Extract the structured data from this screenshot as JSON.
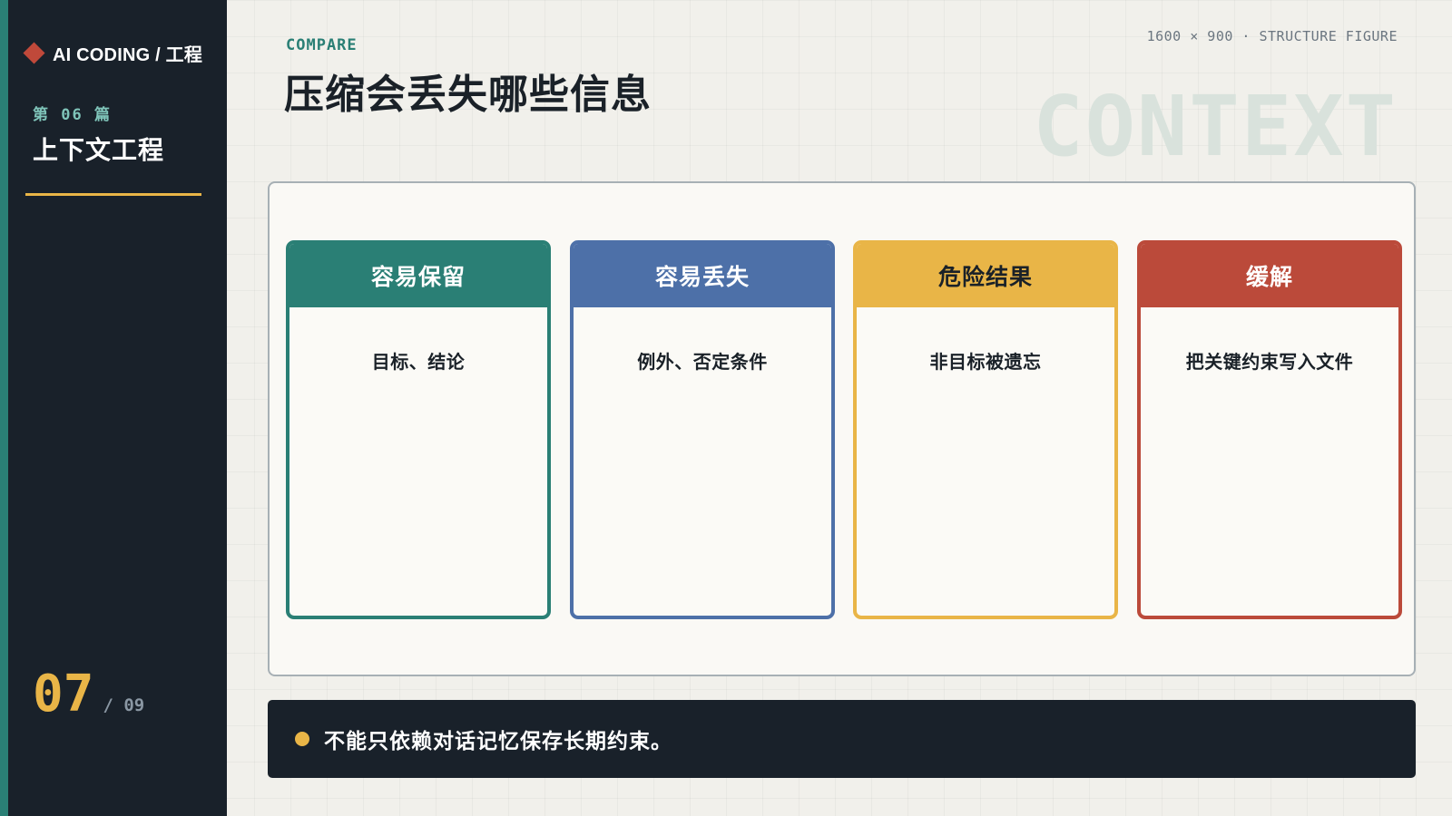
{
  "sidebar": {
    "brand": "AI CODING / 工程",
    "brand_icon": "diamond-icon",
    "episode": "第 06 篇",
    "episode_title": "上下文工程",
    "page_current": "07",
    "page_total": "/ 09"
  },
  "header": {
    "kicker": "COMPARE",
    "title": "压缩会丢失哪些信息",
    "dimension_label": "1600 × 900 · STRUCTURE FIGURE",
    "watermark": "CONTEXT"
  },
  "cards": [
    {
      "title": "容易保留",
      "body": "目标、结论",
      "color": "#2a7f75",
      "title_color": "#ffffff"
    },
    {
      "title": "容易丢失",
      "body": "例外、否定条件",
      "color": "#4d70a8",
      "title_color": "#ffffff"
    },
    {
      "title": "危险结果",
      "body": "非目标被遗忘",
      "color": "#e9b547",
      "title_color": "#1a2128"
    },
    {
      "title": "缓解",
      "body": "把关键约束写入文件",
      "color": "#bb4a3a",
      "title_color": "#ffffff"
    }
  ],
  "callout": {
    "text": "不能只依赖对话记忆保存长期约束。"
  },
  "colors": {
    "sidebar_bg": "#19212a",
    "accent_teal": "#2a7f75",
    "accent_gold": "#e9b547",
    "accent_red": "#c0493a",
    "page_bg": "#f1f0eb"
  }
}
